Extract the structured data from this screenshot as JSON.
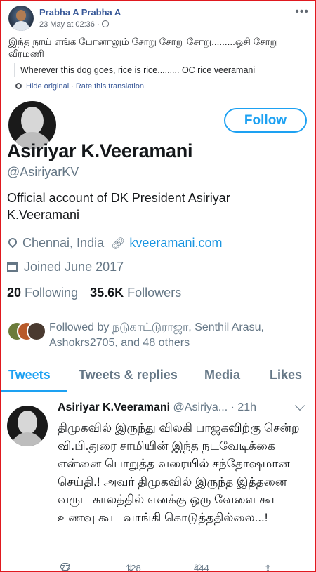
{
  "post": {
    "author": "Prabha A Prabha A",
    "timestamp": "23 May at 02:36 ·",
    "original_text": "இந்த நாய் எங்க போனாலும் சோறு சோறு சோறு.........ஓசி சோறு வீரமணி",
    "translation": "Wherever this dog goes, rice is rice......... OC rice veeramani",
    "hide_original": "Hide original",
    "separator": "·",
    "rate_translation": "Rate this translation",
    "more": "•••"
  },
  "profile": {
    "follow_label": "Follow",
    "name": "Asiriyar K.Veeramani",
    "handle": "@AsiriyarKV",
    "bio": "Official account of DK President Asiriyar K.Veeramani",
    "location": "Chennai, India",
    "website": "kveeramani.com",
    "joined": "Joined June 2017",
    "following_count": "20",
    "following_label": "Following",
    "followers_count": "35.6K",
    "followers_label": "Followers",
    "followed_by": "Followed by நடுகாட்டுராஜா, Senthil Arasu, Ashokrs2705, and 48 others"
  },
  "tabs": [
    {
      "label": "Tweets",
      "active": true
    },
    {
      "label": "Tweets & replies",
      "active": false
    },
    {
      "label": "Media",
      "active": false
    },
    {
      "label": "Likes",
      "active": false
    }
  ],
  "tweet": {
    "name": "Asiriyar K.Veeramani",
    "handle": "@Asiriya...",
    "time": "· 21h",
    "body": "திமுகவில் இருந்து விலகி பாஜகவிற்கு சென்ற வி.பி.துரை சாமியின் இந்த நடவேடிக்கை என்னை பொறுத்த வரையில் சந்தோஷமான செய்தி.! அவர் திமுகவில் இருந்த இத்தனை வருட காலத்தில் எனக்கு ஒரு வேளை கூட உணவு கூட வாங்கி கொடுத்ததில்லை...!",
    "replies": "77",
    "retweets": "128",
    "likes": "444"
  },
  "colors": {
    "frame": "#e0191f",
    "twitter_blue": "#1da1f2",
    "fb_link": "#385898"
  }
}
